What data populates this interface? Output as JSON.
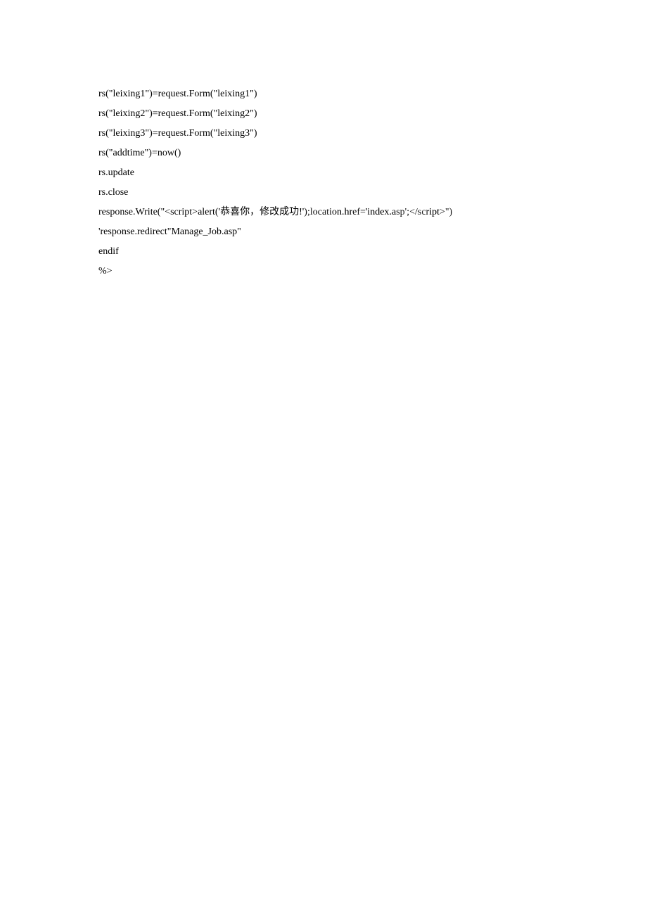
{
  "code": {
    "lines": [
      "rs(\"leixing1\")=request.Form(\"leixing1\")",
      "rs(\"leixing2\")=request.Form(\"leixing2\")",
      "rs(\"leixing3\")=request.Form(\"leixing3\")",
      "rs(\"addtime\")=now()",
      "rs.update",
      "rs.close",
      "response.Write(\"<script>alert('恭喜你，修改成功!');location.href='index.asp';</script>\")",
      "'response.redirect\"Manage_Job.asp\"",
      "endif",
      "%>"
    ]
  }
}
